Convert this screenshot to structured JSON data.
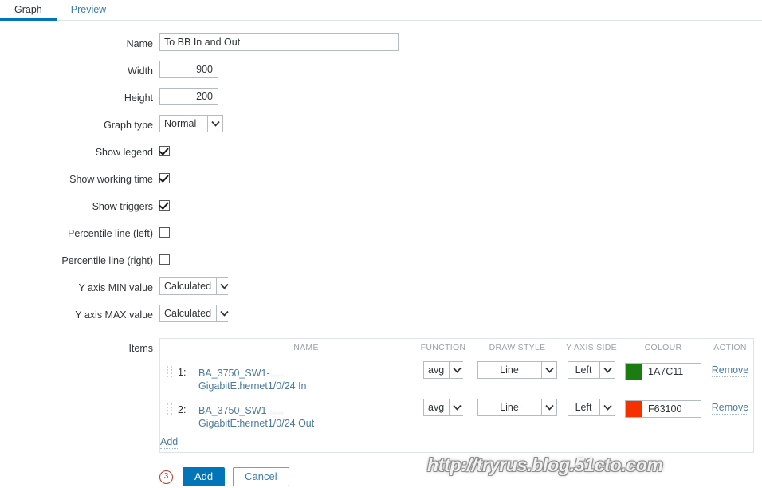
{
  "tabs": [
    {
      "label": "Graph",
      "active": true
    },
    {
      "label": "Preview",
      "active": false
    }
  ],
  "form": {
    "name": {
      "label": "Name",
      "value": "To BB In and Out"
    },
    "width": {
      "label": "Width",
      "value": "900"
    },
    "height": {
      "label": "Height",
      "value": "200"
    },
    "graph_type": {
      "label": "Graph type",
      "value": "Normal"
    },
    "show_legend": {
      "label": "Show legend",
      "checked": true
    },
    "show_working_time": {
      "label": "Show working time",
      "checked": true
    },
    "show_triggers": {
      "label": "Show triggers",
      "checked": true
    },
    "percentile_left": {
      "label": "Percentile line (left)",
      "checked": false
    },
    "percentile_right": {
      "label": "Percentile line (right)",
      "checked": false
    },
    "y_axis_min": {
      "label": "Y axis MIN value",
      "value": "Calculated"
    },
    "y_axis_max": {
      "label": "Y axis MAX value",
      "value": "Calculated"
    },
    "items": {
      "label": "Items"
    }
  },
  "items_table": {
    "headers": {
      "name": "NAME",
      "function": "FUNCTION",
      "draw_style": "DRAW STYLE",
      "y_axis_side": "Y AXIS SIDE",
      "colour": "COLOUR",
      "action": "ACTION"
    },
    "rows": [
      {
        "index": "1:",
        "name_prefix": "BA_3750_SW1-",
        "name_redacted": "....",
        "name_second_line": "GigabitEthernet1/0/24 In",
        "function": "avg",
        "draw_style": "Line",
        "y_axis_side": "Left",
        "colour_hex": "1A7C11",
        "colour_value": "#1A7C11",
        "action": "Remove"
      },
      {
        "index": "2:",
        "name_prefix": "BA_3750_SW1-",
        "name_redacted": "....",
        "name_second_line": "GigabitEthernet1/0/24 Out",
        "function": "avg",
        "draw_style": "Line",
        "y_axis_side": "Left",
        "colour_hex": "F63100",
        "colour_value": "#F63100",
        "action": "Remove"
      }
    ],
    "add_link": "Add"
  },
  "footer": {
    "annotation": "3",
    "submit_label": "Add",
    "cancel_label": "Cancel"
  },
  "watermark": {
    "text": "http://tryrus.blog.51cto.com"
  },
  "colors": {
    "accent": "#0275b8",
    "link": "#4a7b9d",
    "header_text": "#97a3ab",
    "annotation": "#c0392b"
  }
}
